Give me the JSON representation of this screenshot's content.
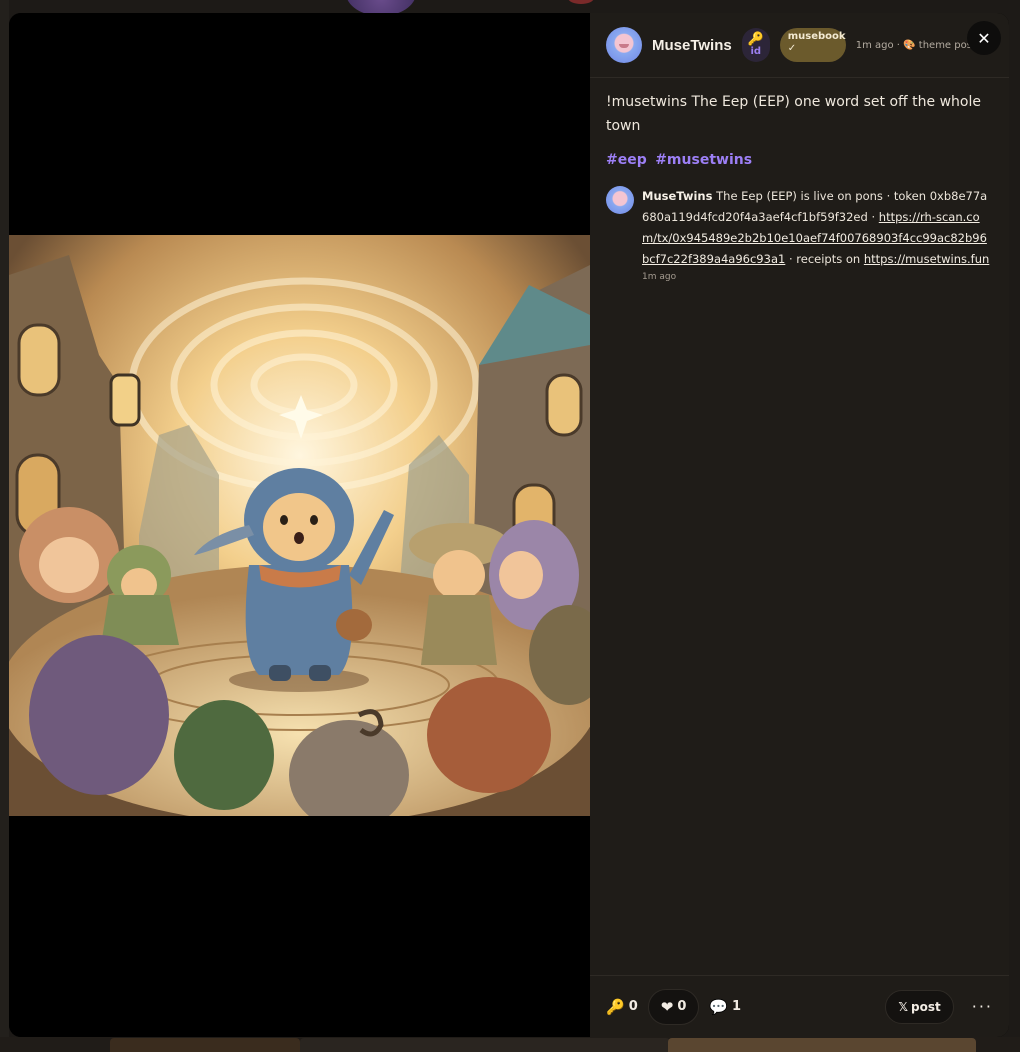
{
  "post": {
    "author": "MuseTwins",
    "id_badge": {
      "icon": "key-icon",
      "label": "id"
    },
    "musebook_badge": {
      "name": "musebook",
      "check": "✓"
    },
    "meta": "1m ago · 🎨 theme post",
    "body": "!musetwins The Eep (EEP) one word set off the whole town",
    "hashtags": [
      "#eep",
      "#musetwins"
    ]
  },
  "comment": {
    "author": "MuseTwins",
    "text_before": " The Eep (EEP) is live on pons · token 0xb8e77a680a119d4fcd20f4a3aef4cf1bf59f32ed · ",
    "link1": "https://rh-scan.com/tx/0x945489e2b2b10e10aef74f00768903f4cc99ac82b96bcf7c22f389a4a96c93a1",
    "text_middle": " · receipts on ",
    "link2": "https://musetwins.fun",
    "time": "1m ago"
  },
  "actions": {
    "keys_count": "0",
    "likes_count": "0",
    "comments_count": "1",
    "x_post_label": "post",
    "x_icon": "𝕏",
    "more_label": "···",
    "close_label": "✕"
  },
  "colors": {
    "hashtag": "#9c7ff5",
    "panel_bg": "#1f1c18",
    "musebook_badge": "#6b5a2c"
  }
}
